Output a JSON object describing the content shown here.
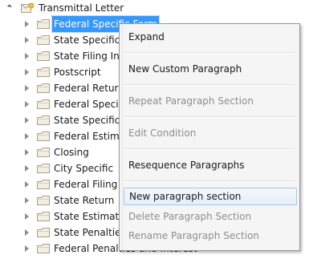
{
  "tree": {
    "root_label": "Transmittal Letter",
    "items": [
      {
        "label": "Federal Specific Form",
        "selected": true
      },
      {
        "label": "State Specific Form"
      },
      {
        "label": "State Filing Instructions"
      },
      {
        "label": "Postscript"
      },
      {
        "label": "Federal Return Filing"
      },
      {
        "label": "Federal Specific"
      },
      {
        "label": "State Specific"
      },
      {
        "label": "Federal Estimates"
      },
      {
        "label": "Closing"
      },
      {
        "label": "City Specific"
      },
      {
        "label": "Federal Filing"
      },
      {
        "label": "State Return"
      },
      {
        "label": "State Estimates"
      },
      {
        "label": "State Penalties"
      },
      {
        "label": "Federal Penalties and Interest"
      }
    ]
  },
  "context_menu": {
    "items": [
      {
        "label": "Expand",
        "enabled": true
      },
      {
        "label": "New Custom Paragraph",
        "enabled": true
      },
      {
        "label": "Repeat Paragraph Section",
        "enabled": false
      },
      {
        "label": "Edit Condition",
        "enabled": false
      },
      {
        "label": "Resequence Paragraphs",
        "enabled": true
      },
      {
        "label": "New paragraph section",
        "enabled": true,
        "highlighted": true
      },
      {
        "label": "Delete Paragraph Section",
        "enabled": false
      },
      {
        "label": "Rename Paragraph Section",
        "enabled": false
      }
    ]
  },
  "colors": {
    "selection": "#3399ff",
    "folder_fill": "#f2eee2",
    "folder_stroke": "#a7a28f",
    "root_icon_accent": "#f5c241",
    "menu_background": "#f5f5f5",
    "disabled_text": "#8d8d8d"
  }
}
